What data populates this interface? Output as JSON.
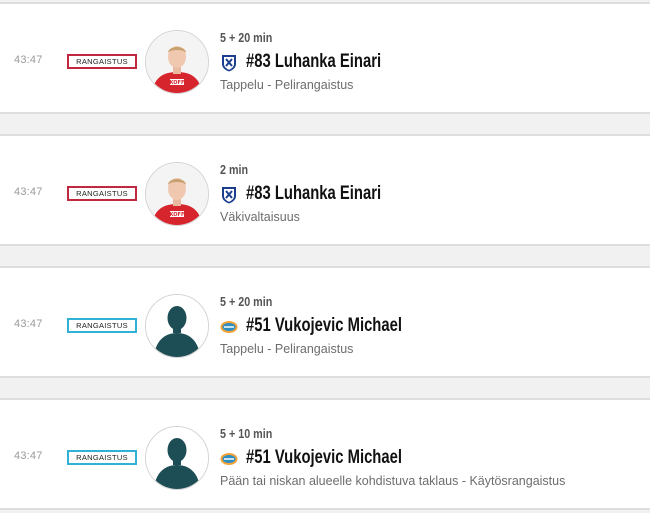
{
  "events": [
    {
      "time": "43:47",
      "type_label": "RANGAISTUS",
      "badge_color": "#c0283f",
      "duration": "5 + 20 min",
      "player": "#83 Luhanka Einari",
      "team_logo": "hifk-logo",
      "avatar": "player-photo",
      "description": "Tappelu - Pelirangaistus"
    },
    {
      "time": "43:47",
      "type_label": "RANGAISTUS",
      "badge_color": "#c0283f",
      "duration": "2 min",
      "player": "#83 Luhanka Einari",
      "team_logo": "hifk-logo",
      "avatar": "player-photo",
      "description": "Väkivaltaisuus"
    },
    {
      "time": "43:47",
      "type_label": "RANGAISTUS",
      "badge_color": "#2fb2d4",
      "duration": "5 + 20 min",
      "player": "#51 Vukojevic Michael",
      "team_logo": "lukko-logo",
      "avatar": "player-silhouette",
      "description": "Tappelu - Pelirangaistus"
    },
    {
      "time": "43:47",
      "type_label": "RANGAISTUS",
      "badge_color": "#2fb2d4",
      "duration": "5 + 10 min",
      "player": "#51 Vukojevic Michael",
      "team_logo": "lukko-logo",
      "avatar": "player-silhouette",
      "description": "Pään tai niskan alueelle kohdistuva taklaus - Käytösrangaistus"
    }
  ]
}
